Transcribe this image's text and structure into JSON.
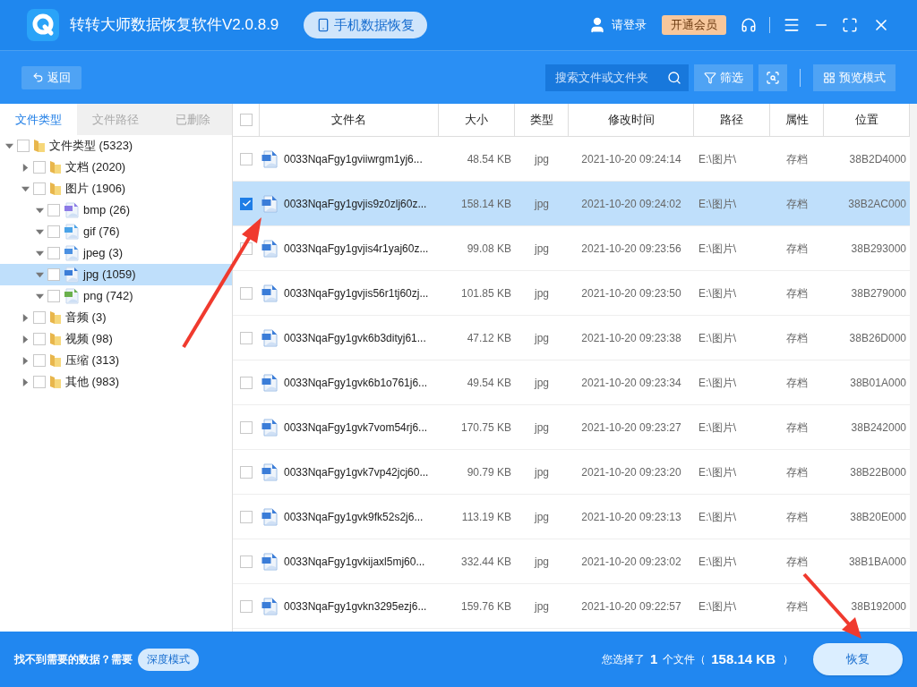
{
  "app": {
    "title": "转转大师数据恢复软件V2.0.8.9",
    "mode_button": "手机数据恢复",
    "login": "请登录",
    "vip": "开通会员"
  },
  "toolbar": {
    "back": "返回",
    "search": {
      "placeholder": "搜索文件或文件夹"
    },
    "filter": "筛选",
    "preview": "预览模式"
  },
  "side_tabs": [
    {
      "label": "文件类型",
      "selected": true
    },
    {
      "label": "文件路径",
      "selected": false
    },
    {
      "label": "已删除",
      "selected": false
    }
  ],
  "tree": [
    {
      "label": "文件类型 (5323)",
      "kind": "folder",
      "expanded": true,
      "checked": false,
      "selected": false,
      "children": [
        {
          "label": "文档 (2020)",
          "kind": "folder",
          "expanded": false,
          "checked": false,
          "selected": false
        },
        {
          "label": "图片 (1906)",
          "kind": "folder",
          "expanded": true,
          "checked": false,
          "selected": false,
          "children": [
            {
              "label": "bmp (26)",
              "kind": "file",
              "color": "#8c7ae6",
              "expanded": true,
              "checked": false,
              "selected": false
            },
            {
              "label": "gif (76)",
              "kind": "file",
              "color": "#4aa3e8",
              "expanded": true,
              "checked": false,
              "selected": false
            },
            {
              "label": "jpeg (3)",
              "kind": "file",
              "color": "#4a90e2",
              "expanded": true,
              "checked": false,
              "selected": false
            },
            {
              "label": "jpg (1059)",
              "kind": "file",
              "color": "#3b7dd8",
              "expanded": true,
              "checked": false,
              "selected": true
            },
            {
              "label": "png (742)",
              "kind": "file",
              "color": "#6ab04c",
              "expanded": true,
              "checked": false,
              "selected": false
            }
          ]
        },
        {
          "label": "音频 (3)",
          "kind": "folder",
          "expanded": false,
          "checked": false,
          "selected": false
        },
        {
          "label": "视频 (98)",
          "kind": "folder",
          "expanded": false,
          "checked": false,
          "selected": false
        },
        {
          "label": "压缩 (313)",
          "kind": "folder",
          "expanded": false,
          "checked": false,
          "selected": false
        },
        {
          "label": "其他 (983)",
          "kind": "folder",
          "expanded": false,
          "checked": false,
          "selected": false
        }
      ]
    }
  ],
  "table": {
    "all_checked": false,
    "columns": [
      "文件名",
      "大小",
      "类型",
      "修改时间",
      "路径",
      "属性",
      "位置"
    ],
    "rows": [
      {
        "selected": false,
        "cells": [
          "0033NqaFgy1gviiwrgm1yj6...",
          "48.54 KB",
          "jpg",
          "2021-10-20 09:24:14",
          "E:\\图片\\",
          "存档",
          "38B2D4000"
        ]
      },
      {
        "selected": true,
        "cells": [
          "0033NqaFgy1gvjis9z0zlj60z...",
          "158.14 KB",
          "jpg",
          "2021-10-20 09:24:02",
          "E:\\图片\\",
          "存档",
          "38B2AC000"
        ]
      },
      {
        "selected": false,
        "cells": [
          "0033NqaFgy1gvjis4r1yaj60z...",
          "99.08 KB",
          "jpg",
          "2021-10-20 09:23:56",
          "E:\\图片\\",
          "存档",
          "38B293000"
        ]
      },
      {
        "selected": false,
        "cells": [
          "0033NqaFgy1gvjis56r1tj60zj...",
          "101.85 KB",
          "jpg",
          "2021-10-20 09:23:50",
          "E:\\图片\\",
          "存档",
          "38B279000"
        ]
      },
      {
        "selected": false,
        "cells": [
          "0033NqaFgy1gvk6b3dityj61...",
          "47.12 KB",
          "jpg",
          "2021-10-20 09:23:38",
          "E:\\图片\\",
          "存档",
          "38B26D000"
        ]
      },
      {
        "selected": false,
        "cells": [
          "0033NqaFgy1gvk6b1o761j6...",
          "49.54 KB",
          "jpg",
          "2021-10-20 09:23:34",
          "E:\\图片\\",
          "存档",
          "38B01A000"
        ]
      },
      {
        "selected": false,
        "cells": [
          "0033NqaFgy1gvk7vom54rj6...",
          "170.75 KB",
          "jpg",
          "2021-10-20 09:23:27",
          "E:\\图片\\",
          "存档",
          "38B242000"
        ]
      },
      {
        "selected": false,
        "cells": [
          "0033NqaFgy1gvk7vp42jcj60...",
          "90.79 KB",
          "jpg",
          "2021-10-20 09:23:20",
          "E:\\图片\\",
          "存档",
          "38B22B000"
        ]
      },
      {
        "selected": false,
        "cells": [
          "0033NqaFgy1gvk9fk52s2j6...",
          "113.19 KB",
          "jpg",
          "2021-10-20 09:23:13",
          "E:\\图片\\",
          "存档",
          "38B20E000"
        ]
      },
      {
        "selected": false,
        "cells": [
          "0033NqaFgy1gvkijaxl5mj60...",
          "332.44 KB",
          "jpg",
          "2021-10-20 09:23:02",
          "E:\\图片\\",
          "存档",
          "38B1BA000"
        ]
      },
      {
        "selected": false,
        "cells": [
          "0033NqaFgy1gvkn3295ezj6...",
          "159.76 KB",
          "jpg",
          "2021-10-20 09:22:57",
          "E:\\图片\\",
          "存档",
          "38B192000"
        ]
      }
    ]
  },
  "footer": {
    "hint": "找不到需要的数据？需要",
    "deep_mode": "深度模式",
    "summary_prefix": "您选择了",
    "count": "1",
    "summary_mid": "个文件（",
    "total": "158.14 KB",
    "summary_suffix": "）",
    "recover": "恢复"
  }
}
